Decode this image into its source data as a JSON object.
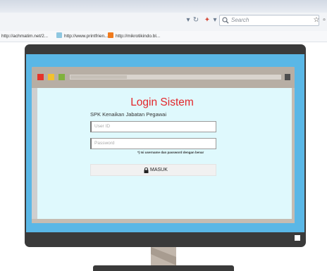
{
  "browser": {
    "search_placeholder": "Search",
    "bookmarks": [
      "http://achmatim.net/2...",
      "http://www.printfrien...",
      "http://mikrotikindo.bl..."
    ]
  },
  "login": {
    "title": "Login Sistem",
    "subtitle": "SPK Kenaikan Jabatan Pegawai",
    "userid_placeholder": "User ID",
    "password_placeholder": "Password",
    "hint": "*) Isi username dan password dengan benar",
    "submit_label": "MASUK"
  },
  "colors": {
    "title_red": "#e3262b",
    "screen_blue": "#5ab7e6",
    "content_bg": "#dff9fd",
    "monitor_dark": "#3a3a3a",
    "dot_red": "#e5332a",
    "dot_yellow": "#f2c12e",
    "dot_green": "#7fb23c"
  }
}
